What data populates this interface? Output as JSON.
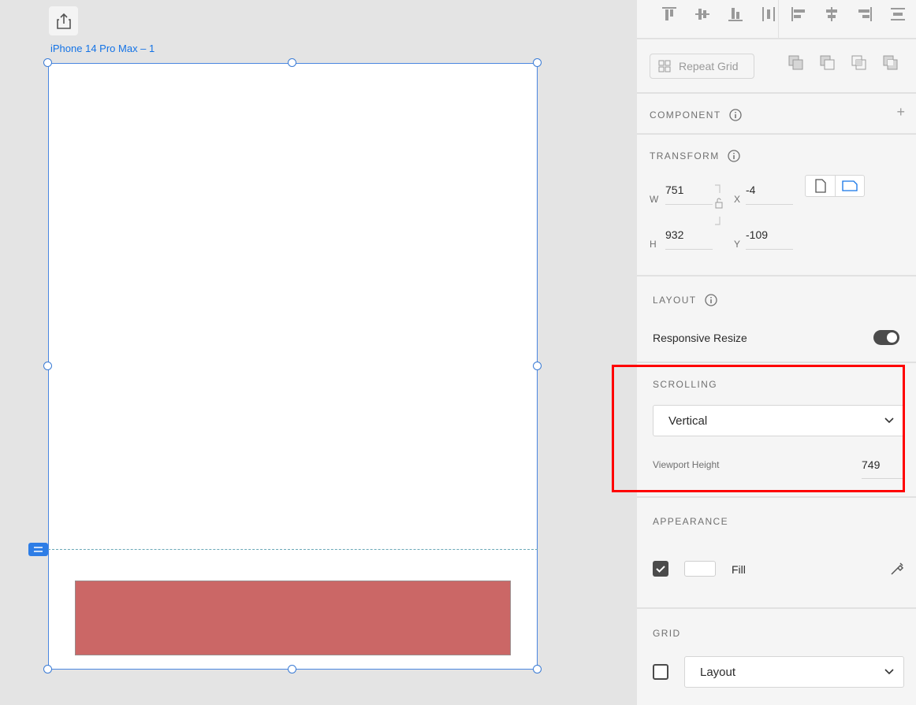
{
  "canvas": {
    "artboard_name": "iPhone 14 Pro Max – 1",
    "share_icon": "share-icon",
    "colors": {
      "selection": "#4a86e0",
      "rect_fill": "#cb6766",
      "viewport_line": "#6aa8b8"
    }
  },
  "panel": {
    "repeat_grid_label": "Repeat Grid",
    "component": {
      "title": "COMPONENT",
      "add_icon": "+"
    },
    "transform": {
      "title": "TRANSFORM",
      "w_label": "W",
      "w_value": "751",
      "h_label": "H",
      "h_value": "932",
      "x_label": "X",
      "x_value": "-4",
      "y_label": "Y",
      "y_value": "-109"
    },
    "layout": {
      "title": "LAYOUT",
      "responsive_label": "Responsive Resize",
      "responsive_on": true
    },
    "scrolling": {
      "title": "SCROLLING",
      "mode": "Vertical",
      "viewport_label": "Viewport Height",
      "viewport_value": "749"
    },
    "appearance": {
      "title": "APPEARANCE",
      "fill_label": "Fill",
      "fill_checked": true
    },
    "grid": {
      "title": "GRID",
      "grid_type": "Layout",
      "grid_checked": false
    }
  },
  "annotation": {
    "color": "#ff0000"
  }
}
